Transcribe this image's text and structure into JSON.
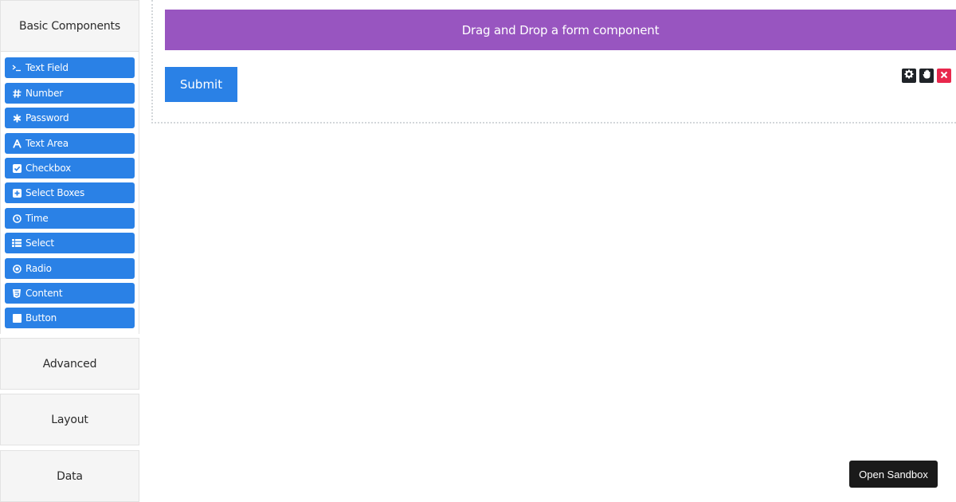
{
  "sidebar": {
    "basic_title": "Basic Components",
    "components": [
      {
        "icon": "terminal-icon",
        "label": "Text Field"
      },
      {
        "icon": "hash-icon",
        "label": "Number"
      },
      {
        "icon": "asterisk-icon",
        "label": "Password"
      },
      {
        "icon": "font-icon",
        "label": "Text Area"
      },
      {
        "icon": "check-square-icon",
        "label": "Checkbox"
      },
      {
        "icon": "plus-square-icon",
        "label": "Select Boxes"
      },
      {
        "icon": "clock-icon",
        "label": "Time"
      },
      {
        "icon": "list-icon",
        "label": "Select"
      },
      {
        "icon": "dot-circle-icon",
        "label": "Radio"
      },
      {
        "icon": "html5-icon",
        "label": "Content"
      },
      {
        "icon": "stop-icon",
        "label": "Button"
      }
    ],
    "sections": [
      {
        "label": "Advanced"
      },
      {
        "label": "Layout"
      },
      {
        "label": "Data"
      }
    ]
  },
  "form": {
    "drop_zone_text": "Drag and Drop a form component",
    "submit_label": "Submit",
    "tools": [
      {
        "icon": "gear-icon"
      },
      {
        "icon": "hand-icon"
      },
      {
        "icon": "close-icon"
      }
    ]
  },
  "sandbox_label": "Open Sandbox",
  "colors": {
    "component_button": "#2a81e6",
    "drop_zone": "#9855c0",
    "remove_tool": "#e8274c",
    "dark_tool": "#1f2328"
  }
}
